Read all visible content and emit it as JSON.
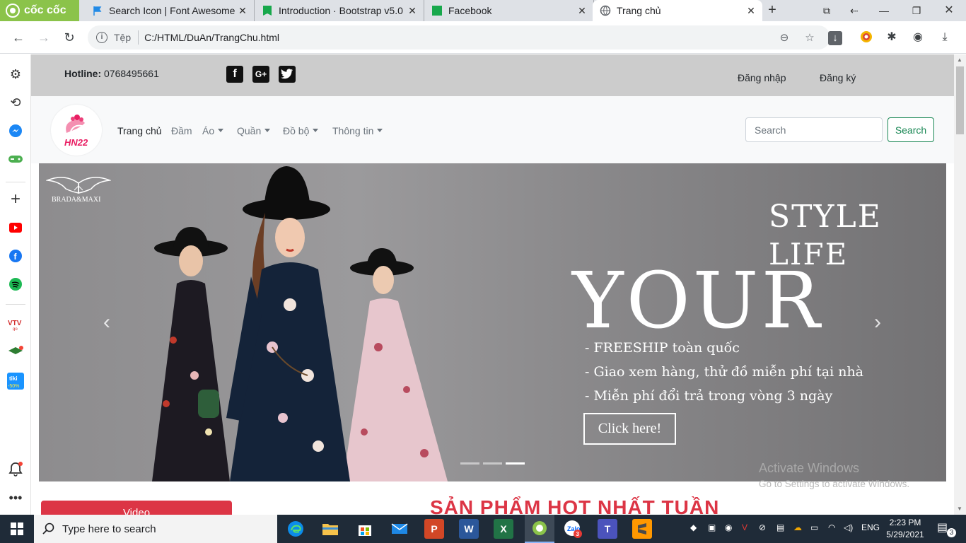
{
  "browser": {
    "tabs": [
      {
        "title": "",
        "label": "cốc cốc"
      },
      {
        "title": "Search Icon | Font Awesome"
      },
      {
        "title": "Introduction · Bootstrap v5.0"
      },
      {
        "title": "Facebook"
      },
      {
        "title": "Trang chủ"
      }
    ],
    "address": {
      "prefix": "Tệp",
      "url": "C:/HTML/DuAn/TrangChu.html"
    }
  },
  "page": {
    "topbar": {
      "hotline_label": "Hotline:",
      "hotline_number": "0768495661",
      "login": "Đăng nhập",
      "register": "Đăng ký",
      "social": [
        "facebook-icon",
        "google-plus-icon",
        "twitter-icon"
      ]
    },
    "logo_text": "HN22",
    "nav": [
      {
        "label": "Trang chủ",
        "active": true,
        "dropdown": false
      },
      {
        "label": "Đầm",
        "active": false,
        "dropdown": false
      },
      {
        "label": "Áo",
        "active": false,
        "dropdown": true
      },
      {
        "label": "Quần",
        "active": false,
        "dropdown": true
      },
      {
        "label": "Đồ bộ",
        "active": false,
        "dropdown": true
      },
      {
        "label": "Thông tin",
        "active": false,
        "dropdown": true
      }
    ],
    "search": {
      "placeholder": "Search",
      "button": "Search"
    },
    "carousel": {
      "brand": "BRADA&MAXI",
      "line_style": "STYLE",
      "line_life": "LIFE",
      "line_your": "YOUR",
      "bullets": [
        "- FREESHIP toàn quốc",
        "- Giao xem hàng, thử đồ miễn phí tại nhà",
        "- Miễn phí đổi trả trong vòng 3 ngày"
      ],
      "cta": "Click here!",
      "active_slide": 3,
      "slide_count": 3
    },
    "video_button": "Video",
    "hot_heading": "SẢN PHẨM HOT NHẤT TUẦN",
    "watermark": {
      "line1": "Activate Windows",
      "line2": "Go to Settings to activate Windows."
    }
  },
  "taskbar": {
    "search_placeholder": "Type here to search",
    "time": "2:23 PM",
    "date": "5/29/2021",
    "language": "ENG",
    "notification_count": "3",
    "zalo_badge": "3"
  }
}
